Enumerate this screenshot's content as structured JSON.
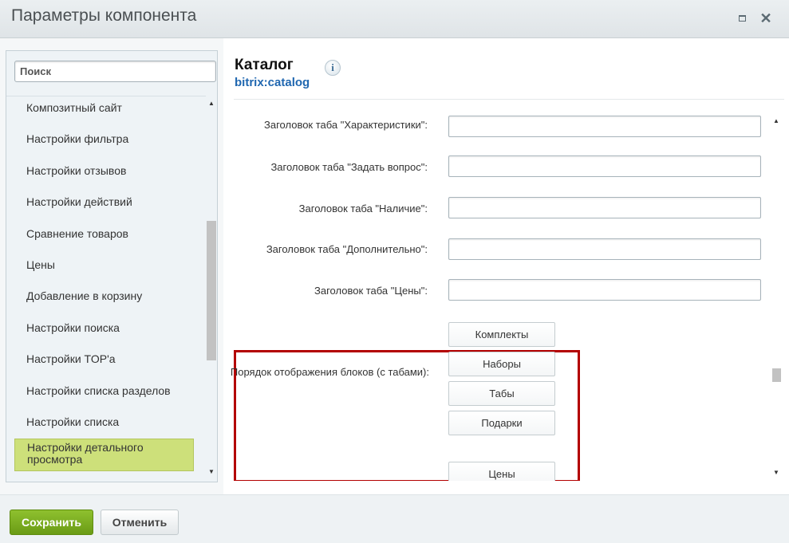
{
  "window": {
    "title": "Параметры компонента"
  },
  "sidebar": {
    "search_placeholder": "Поиск",
    "items": [
      {
        "label": "Композитный сайт"
      },
      {
        "label": "Настройки фильтра"
      },
      {
        "label": "Настройки отзывов"
      },
      {
        "label": "Настройки действий"
      },
      {
        "label": "Сравнение товаров"
      },
      {
        "label": "Цены"
      },
      {
        "label": "Добавление в корзину"
      },
      {
        "label": "Настройки поиска"
      },
      {
        "label": "Настройки TOP'а"
      },
      {
        "label": "Настройки списка разделов"
      },
      {
        "label": "Настройки списка"
      },
      {
        "label": "Настройки детального просмотра",
        "active": true
      }
    ]
  },
  "component": {
    "title": "Каталог",
    "code": "bitrix:catalog",
    "info_icon": "info-icon"
  },
  "form": {
    "fields": [
      {
        "label": "Заголовок таба \"Характеристики\":",
        "value": ""
      },
      {
        "label": "Заголовок таба \"Задать вопрос\":",
        "value": ""
      },
      {
        "label": "Заголовок таба \"Наличие\":",
        "value": ""
      },
      {
        "label": "Заголовок таба \"Дополнительно\":",
        "value": ""
      },
      {
        "label": "Заголовок таба \"Цены\":",
        "value": ""
      }
    ],
    "order_label": "Порядок отображения блоков (с табами):",
    "order_items": [
      "Комплекты",
      "Наборы",
      "Табы",
      "Подарки"
    ],
    "next_item": "Цены"
  },
  "footer": {
    "save_label": "Сохранить",
    "cancel_label": "Отменить"
  },
  "colors": {
    "highlight_border": "#b30000",
    "active_item": "#cde07a",
    "save_button": "#7aad1f",
    "link_blue": "#2067b0"
  }
}
